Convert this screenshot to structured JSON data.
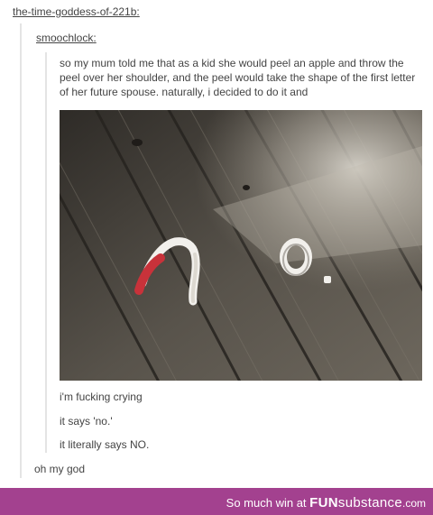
{
  "post": {
    "reblogger": "the-time-goddess-of-221b",
    "original_poster": "smoochlock",
    "colon": ":",
    "original_text": "so my mum told me that as a kid she would peel an apple and throw the peel over her shoulder, and the peel would take the shape of the first letter of her future spouse. naturally, i decided to do it and",
    "image": {
      "subject": "apple peel on wooden floor",
      "colors": {
        "wood_dark": "#3c3934",
        "wood_mid": "#5f5a52",
        "wood_light": "#8a8478",
        "sun": "#c8c4bb",
        "peel_red": "#c8323a",
        "peel_white": "#f2f0ec"
      }
    },
    "replies": [
      {
        "text": "i'm fucking crying"
      },
      {
        "text": "it says 'no.'"
      },
      {
        "text": "it literally says NO."
      }
    ],
    "final_reply": "oh my god"
  },
  "footer": {
    "tagline": "So much win at",
    "brand_bold": "FUN",
    "brand_rest": "substance",
    "domain_suffix": ".com",
    "background_color": "#a3418f"
  }
}
